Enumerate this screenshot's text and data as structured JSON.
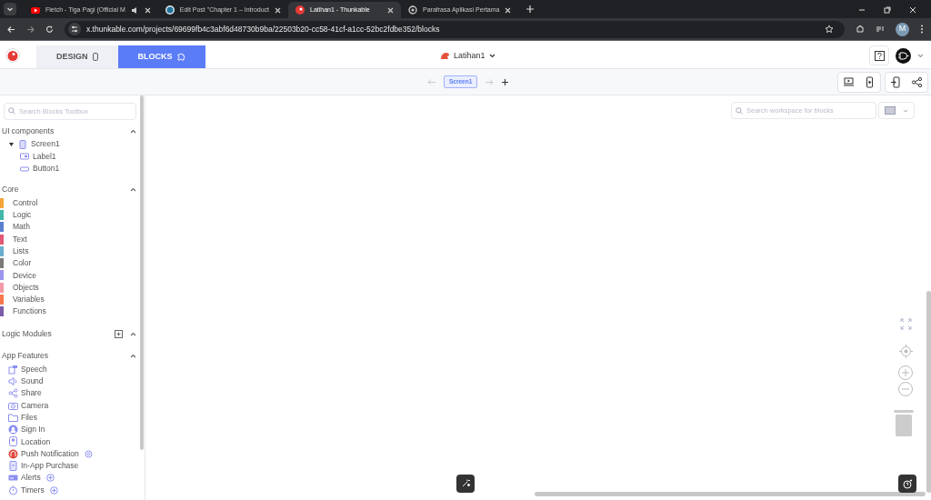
{
  "browser": {
    "tabs": [
      {
        "title": "Fletch - Tiga Pagi (Official M",
        "selected": false,
        "audio": true
      },
      {
        "title": "Edit Post \"Chapter 1 – Introduct",
        "selected": false,
        "audio": false
      },
      {
        "title": "Latihan1 - Thunkable",
        "selected": true,
        "audio": false
      },
      {
        "title": "Parafrasa Aplikasi Pertama",
        "selected": false,
        "audio": false
      }
    ],
    "url": "x.thunkable.com/projects/69699fb4c3abf6d48730b9ba/22503b20-cc58-41cf-a1cc-52bc2fdbe352/blocks",
    "profile": "M"
  },
  "header": {
    "modes": [
      {
        "label": "DESIGN",
        "selected": false
      },
      {
        "label": "BLOCKS",
        "selected": true
      }
    ],
    "project": "Latihan1",
    "screen": "Screen1"
  },
  "sidebar": {
    "search": {
      "placeholder": "Search Blocks Toolbox"
    },
    "ui_components": {
      "title": "UI components",
      "expanded": true,
      "tree": [
        {
          "label": "Screen1",
          "expanded": true,
          "children": [
            {
              "label": "Label1"
            },
            {
              "label": "Button1"
            }
          ]
        }
      ]
    },
    "core": {
      "title": "Core",
      "expanded": true,
      "items": [
        {
          "label": "Control",
          "color": "#f3a53b"
        },
        {
          "label": "Logic",
          "color": "#3fb8a8"
        },
        {
          "label": "Math",
          "color": "#5b7fd0"
        },
        {
          "label": "Text",
          "color": "#e05873"
        },
        {
          "label": "Lists",
          "color": "#6aaed0"
        },
        {
          "label": "Color",
          "color": "#7a7a7a"
        },
        {
          "label": "Device",
          "color": "#9b95ee"
        },
        {
          "label": "Objects",
          "color": "#f49aa6"
        },
        {
          "label": "Variables",
          "color": "#f5784f"
        },
        {
          "label": "Functions",
          "color": "#7b5ca8"
        }
      ]
    },
    "logic_modules": {
      "title": "Logic Modules",
      "expanded": true
    },
    "app_features": {
      "title": "App Features",
      "expanded": true,
      "items": [
        {
          "label": "Speech",
          "kind": "plain"
        },
        {
          "label": "Sound",
          "kind": "plain"
        },
        {
          "label": "Share",
          "kind": "plain"
        },
        {
          "label": "Camera",
          "kind": "plain"
        },
        {
          "label": "Files",
          "kind": "plain"
        },
        {
          "label": "Sign In",
          "kind": "plain"
        },
        {
          "label": "Location",
          "kind": "plain"
        },
        {
          "label": "Push Notification",
          "kind": "settings"
        },
        {
          "label": "In-App Purchase",
          "kind": "plain"
        },
        {
          "label": "Alerts",
          "kind": "add"
        },
        {
          "label": "Timers",
          "kind": "add"
        }
      ]
    }
  },
  "workspace": {
    "search": {
      "placeholder": "Search workspace for blocks"
    }
  }
}
